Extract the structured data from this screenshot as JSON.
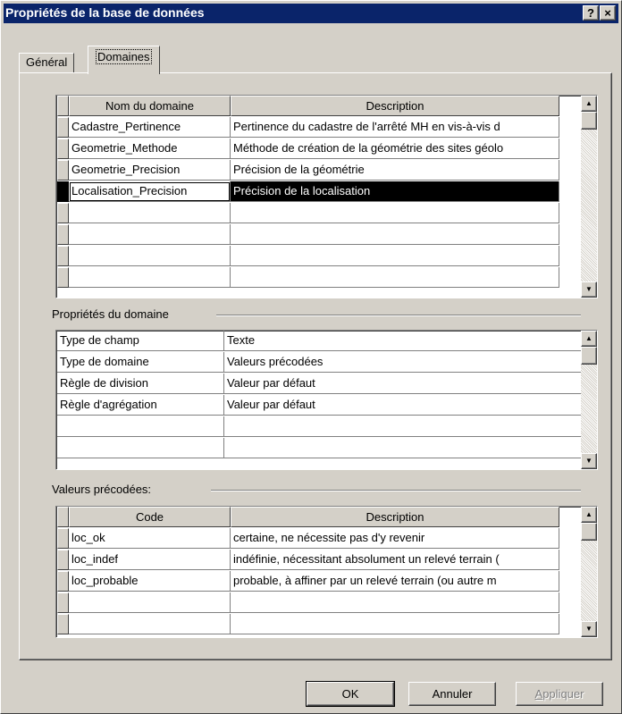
{
  "window": {
    "title": "Propriétés de la base de données",
    "help_glyph": "?",
    "close_glyph": "×"
  },
  "tabs": [
    {
      "label": "Général"
    },
    {
      "label": "Domaines"
    }
  ],
  "domains_grid": {
    "headers": [
      "Nom du domaine",
      "Description"
    ],
    "rows": [
      {
        "name": "Cadastre_Pertinence",
        "description": "Pertinence du cadastre de l'arrêté MH en vis-à-vis d"
      },
      {
        "name": "Geometrie_Methode",
        "description": "Méthode de création de la géométrie des sites géolo"
      },
      {
        "name": "Geometrie_Precision",
        "description": "Précision de la géométrie"
      },
      {
        "name": "Localisation_Precision",
        "description": "Précision de la localisation"
      }
    ],
    "selected_row": 3
  },
  "domain_properties": {
    "label": "Propriétés du domaine",
    "rows": [
      {
        "key": "Type de champ",
        "value": "Texte"
      },
      {
        "key": "Type de domaine",
        "value": "Valeurs précodées"
      },
      {
        "key": "Règle de division",
        "value": "Valeur par défaut"
      },
      {
        "key": "Règle d'agrégation",
        "value": "Valeur par défaut"
      }
    ]
  },
  "coded_values": {
    "label": "Valeurs précodées:",
    "headers": [
      "Code",
      "Description"
    ],
    "rows": [
      {
        "code": "loc_ok",
        "description": "certaine, ne nécessite pas d'y revenir"
      },
      {
        "code": "loc_indef",
        "description": "indéfinie, nécessitant absolument un relevé terrain ("
      },
      {
        "code": "loc_probable",
        "description": "probable, à affiner par un relevé terrain (ou autre m"
      }
    ]
  },
  "buttons": {
    "ok": "OK",
    "cancel": "Annuler",
    "apply_mnemonic": "A",
    "apply_rest": "ppliquer"
  },
  "icons": {
    "scroll_up": "scroll-up-arrow-icon",
    "scroll_down": "scroll-down-arrow-icon"
  },
  "colors": {
    "titlebar": "#0a246a",
    "face": "#d4d0c8",
    "selection": "#000000"
  }
}
